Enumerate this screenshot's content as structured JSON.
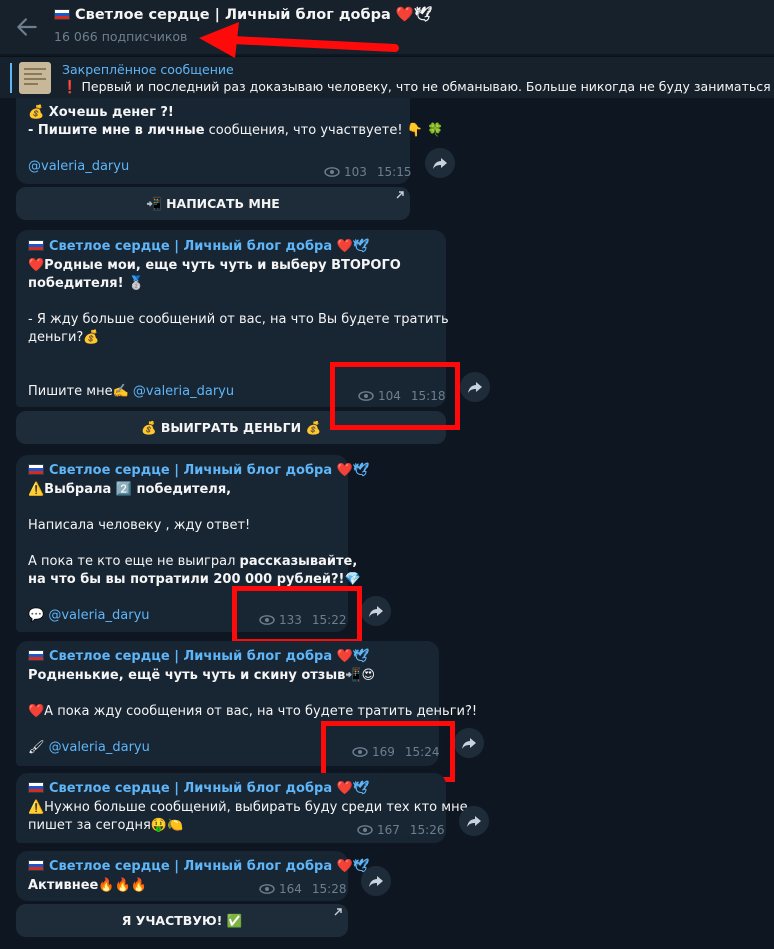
{
  "header": {
    "title": "🇷🇺 Светлое сердце | Личный блог добра ❤️🕊",
    "subscribers": "16 066 подписчиков"
  },
  "pinned": {
    "label": "Закреплённое сообщение",
    "text": "❗ Первый и последний раз доказываю человеку, что не обманываю. Больше никогда не буду заниматься этим ц"
  },
  "channel_name": "Светлое сердце | Личный блог добра ❤️🕊",
  "messages": [
    {
      "lines": [
        "💰 Хочешь денег ?!",
        "- Пишите мне в личные сообщения, что участвуете! 👇 🍀"
      ],
      "link": "@valeria_daryu",
      "views": "103",
      "time": "15:15",
      "button": "📲 НАПИСАТЬ МНЕ"
    },
    {
      "lines": [
        "❤️Родные мои, еще чуть чуть и выберу ВТОРОГО",
        "победителя! 🥈",
        "",
        "- Я жду больше сообщений от вас, на что Вы будете тратить",
        "деньги?💰"
      ],
      "prefix": "Пишите мне✍️",
      "link": "@valeria_daryu",
      "views": "104",
      "time": "15:18",
      "button": "💰 ВЫИГРАТЬ ДЕНЬГИ 💰"
    },
    {
      "lines": [
        "⚠️Выбрала 2️⃣ победителя,",
        "",
        "Написала человеку , жду ответ!",
        "",
        " А пока те кто еще не выиграл рассказывайте,",
        "на что бы вы потратили 200 000 рублей?!💎"
      ],
      "prefix": "💬",
      "link": "@valeria_daryu",
      "views": "133",
      "time": "15:22"
    },
    {
      "lines": [
        "Родненькие, ещё чуть чуть и скину отзыв📲😍",
        "",
        "❤️А пока жду сообщения от вас, на что будете тратить деньги?!"
      ],
      "prefix": "🖌",
      "link": "@valeria_daryu",
      "views": "169",
      "time": "15:24"
    },
    {
      "lines": [
        "⚠️Нужно больше сообщений, выбирать буду среди тех кто мне",
        "пишет за сегодня🤑🍋"
      ],
      "views": "167",
      "time": "15:26"
    },
    {
      "lines": [
        "Активнее🔥🔥🔥"
      ],
      "views": "164",
      "time": "15:28",
      "button": "Я УЧАСТВУЮ! ✅"
    }
  ],
  "icons": [
    "back-arrow-icon",
    "russia-flag-icon",
    "eye-icon",
    "share-forward-icon",
    "external-link-icon"
  ],
  "colors": {
    "background": "#0e1621",
    "bubble": "#182533",
    "accent": "#5eb5f7",
    "highlight": "#ff0a0a"
  }
}
